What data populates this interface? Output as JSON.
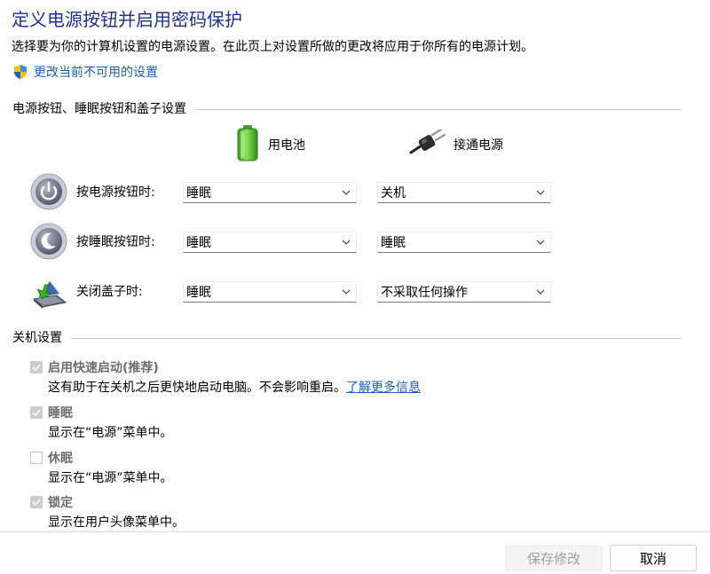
{
  "header": {
    "title": "定义电源按钮并启用密码保护",
    "description": "选择要为你的计算机设置的电源设置。在此页上对设置所做的更改将应用于你所有的电源计划。",
    "admin_link": "更改当前不可用的设置"
  },
  "power_section": {
    "title": "电源按钮、睡眠按钮和盖子设置",
    "columns": {
      "battery": "用电池",
      "plugged_in": "接通电源"
    },
    "rows": [
      {
        "label": "按电源按钮时:",
        "battery": "睡眠",
        "plugged_in": "关机"
      },
      {
        "label": "按睡眠按钮时:",
        "battery": "睡眠",
        "plugged_in": "睡眠"
      },
      {
        "label": "关闭盖子时:",
        "battery": "睡眠",
        "plugged_in": "不采取任何操作"
      }
    ]
  },
  "shutdown_section": {
    "title": "关机设置",
    "items": [
      {
        "label": "启用快速启动(推荐)",
        "desc": "这有助于在关机之后更快地启动电脑。不会影响重启。",
        "link": "了解更多信息",
        "checked": true
      },
      {
        "label": "睡眠",
        "desc": "显示在“电源”菜单中。",
        "checked": true
      },
      {
        "label": "休眠",
        "desc": "显示在“电源”菜单中。",
        "checked": false
      },
      {
        "label": "锁定",
        "desc": "显示在用户头像菜单中。",
        "checked": true
      }
    ]
  },
  "footer": {
    "save_label": "保存修改",
    "cancel_label": "取消"
  },
  "icons": {
    "admin": "uac-shield-icon",
    "battery": "battery-icon",
    "plug": "power-plug-icon",
    "power_button": "power-button-icon",
    "sleep_button": "sleep-button-icon",
    "lid": "laptop-lid-icon",
    "dropdown": "chevron-down-icon"
  },
  "colors": {
    "title": "#1e3287",
    "link": "#1a5fb4",
    "disabled_text": "#6d6d6d"
  }
}
